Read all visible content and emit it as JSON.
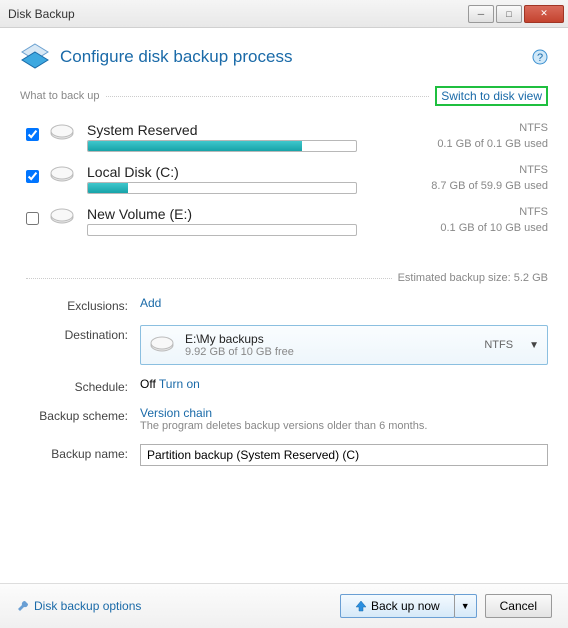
{
  "window": {
    "title": "Disk Backup"
  },
  "header": {
    "title": "Configure disk backup process"
  },
  "what_section": {
    "label": "What to back up",
    "switch_link": "Switch to disk view"
  },
  "volumes": [
    {
      "checked": true,
      "name": "System Reserved",
      "fs": "NTFS",
      "usage": "0.1 GB of 0.1 GB used",
      "fill_pct": 80
    },
    {
      "checked": true,
      "name": "Local Disk (C:)",
      "fs": "NTFS",
      "usage": "8.7 GB of 59.9 GB used",
      "fill_pct": 15
    },
    {
      "checked": false,
      "name": "New Volume (E:)",
      "fs": "NTFS",
      "usage": "0.1 GB of 10 GB used",
      "fill_pct": 0
    }
  ],
  "estimate": {
    "label": "Estimated backup size:",
    "value": "5.2 GB"
  },
  "exclusions": {
    "label": "Exclusions:",
    "add": "Add"
  },
  "destination": {
    "label": "Destination:",
    "path": "E:\\My backups",
    "free": "9.92 GB of 10 GB free",
    "fs": "NTFS"
  },
  "schedule": {
    "label": "Schedule:",
    "status": "Off",
    "turn_on": "Turn on"
  },
  "scheme": {
    "label": "Backup scheme:",
    "name": "Version chain",
    "desc": "The program deletes backup versions older than 6 months."
  },
  "name": {
    "label": "Backup name:",
    "value": "Partition backup (System Reserved) (C)"
  },
  "footer": {
    "options": "Disk backup options",
    "backup": "Back up now",
    "cancel": "Cancel"
  }
}
